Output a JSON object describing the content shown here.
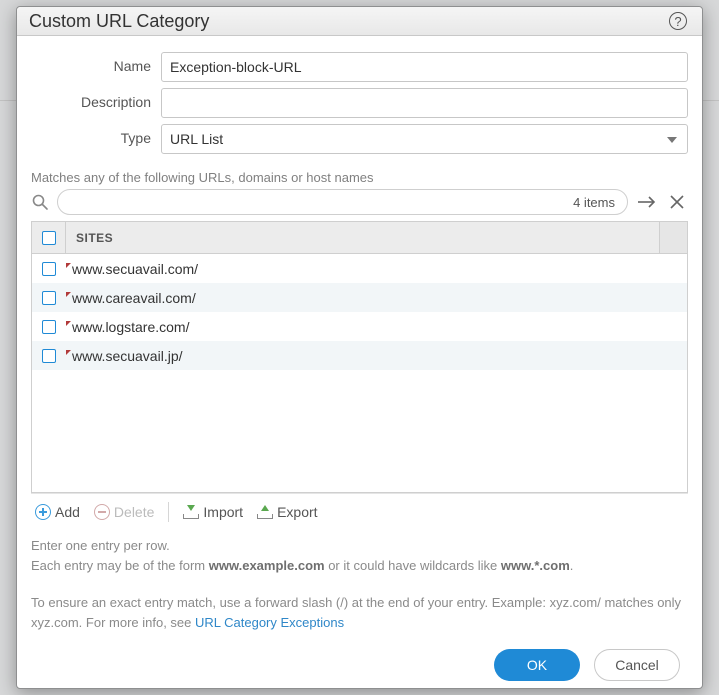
{
  "header": {
    "title": "Custom URL Category"
  },
  "form": {
    "name_label": "Name",
    "name_value": "Exception-block-URL",
    "desc_label": "Description",
    "desc_value": "",
    "type_label": "Type",
    "type_value": "URL List"
  },
  "matches_label": "Matches any of the following URLs, domains or host names",
  "search": {
    "count_label": "4 items"
  },
  "table": {
    "header": "SITES",
    "rows": [
      {
        "site": "www.secuavail.com/"
      },
      {
        "site": "www.careavail.com/"
      },
      {
        "site": "www.logstare.com/"
      },
      {
        "site": "www.secuavail.jp/"
      }
    ]
  },
  "actions": {
    "add": "Add",
    "delete": "Delete",
    "import": "Import",
    "export": "Export"
  },
  "help": {
    "line1a": "Enter one entry per row.",
    "line2a": "Each entry may be of the form ",
    "line2b": "www.example.com",
    "line2c": " or it could have wildcards like ",
    "line2d": "www.*.com",
    "line2e": ".",
    "para2a": "To ensure an exact entry match, use a forward slash (/) at the end of your entry. Example: xyz.com/ matches only xyz.com. For more info, see ",
    "link": "URL Category Exceptions"
  },
  "footer": {
    "ok": "OK",
    "cancel": "Cancel"
  }
}
